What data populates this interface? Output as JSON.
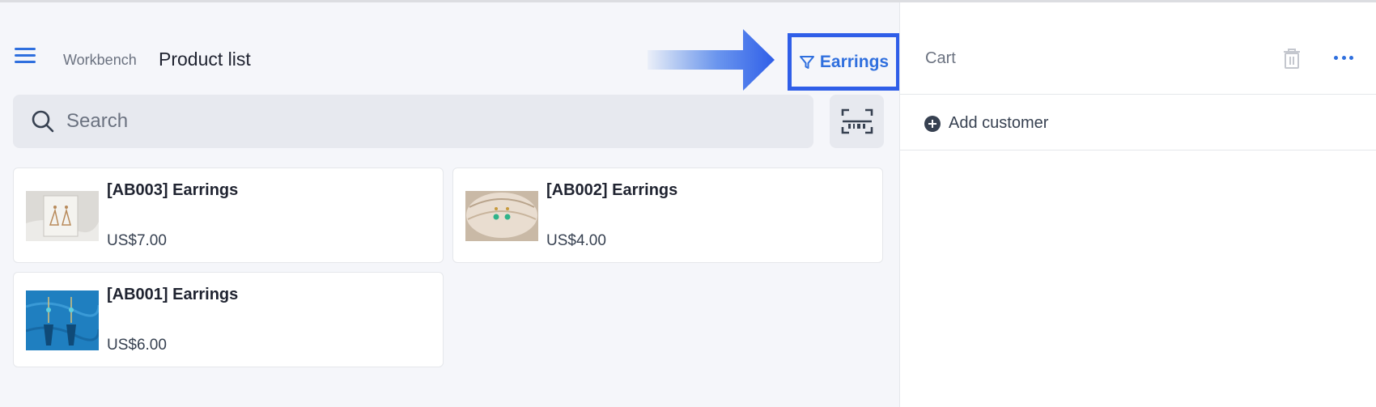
{
  "header": {
    "breadcrumb": "Workbench",
    "title": "Product list"
  },
  "filter": {
    "label": "Earrings",
    "icon": "filter-icon"
  },
  "search": {
    "placeholder": "Search",
    "value": ""
  },
  "products": [
    {
      "name": "[AB003] Earrings",
      "price": "US$7.00"
    },
    {
      "name": "[AB002] Earrings",
      "price": "US$4.00"
    },
    {
      "name": "[AB001] Earrings",
      "price": "US$6.00"
    }
  ],
  "cart": {
    "title": "Cart",
    "add_customer_label": "Add customer"
  },
  "colors": {
    "accent": "#2f6fde",
    "highlight_border": "#2f5ee8",
    "background": "#f5f6fa"
  }
}
